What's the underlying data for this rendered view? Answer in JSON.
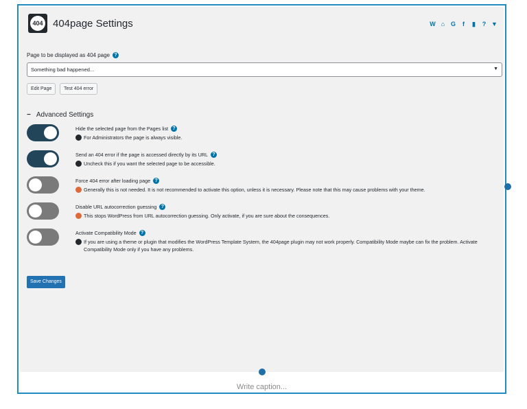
{
  "header": {
    "logo_text": "404",
    "title": "404page Settings",
    "social_icons": [
      "wordpress-icon",
      "home-icon",
      "google-plus-icon",
      "facebook-icon",
      "book-icon",
      "help-icon",
      "thumbs-down-icon"
    ]
  },
  "page_select": {
    "label": "Page to be displayed as 404 page",
    "value": "Something bad happened...",
    "buttons": [
      "Edit Page",
      "Test 404 error"
    ]
  },
  "advanced": {
    "heading": "Advanced Settings",
    "settings": [
      {
        "title": "Hide the selected page from the Pages list",
        "desc": "For Administrators the page is always visible.",
        "enabled": true,
        "icon": "info"
      },
      {
        "title": "Send an 404 error if the page is accessed directly by its URL",
        "desc": "Uncheck this if you want the selected page to be accessible.",
        "enabled": true,
        "icon": "info"
      },
      {
        "title": "Force 404 error after loading page",
        "desc": "Generally this is not needed. It is not recommended to activate this option, unless it is necessary. Please note that this may cause problems with your theme.",
        "enabled": false,
        "icon": "warning"
      },
      {
        "title": "Disable URL autocorrection guessing",
        "desc": "This stops WordPress from URL autocorrection guessing. Only activate, if you are sure about the consequences.",
        "enabled": false,
        "icon": "warning"
      },
      {
        "title": "Activate Compatibility Mode",
        "desc": "If you are using a theme or plugin that modifies the WordPress Template System, the 404page plugin may not work properly. Compatibility Mode maybe can fix the problem. Activate Compatibility Mode only if you have any problems.",
        "enabled": false,
        "icon": "info"
      }
    ]
  },
  "save_label": "Save Changes",
  "caption_placeholder": "Write caption...",
  "colors": {
    "accent": "#2271b1",
    "frame": "#1e8cbe",
    "toggle_on": "#23455a",
    "toggle_off": "#7a7a7a",
    "warning": "#dc6a3a"
  }
}
